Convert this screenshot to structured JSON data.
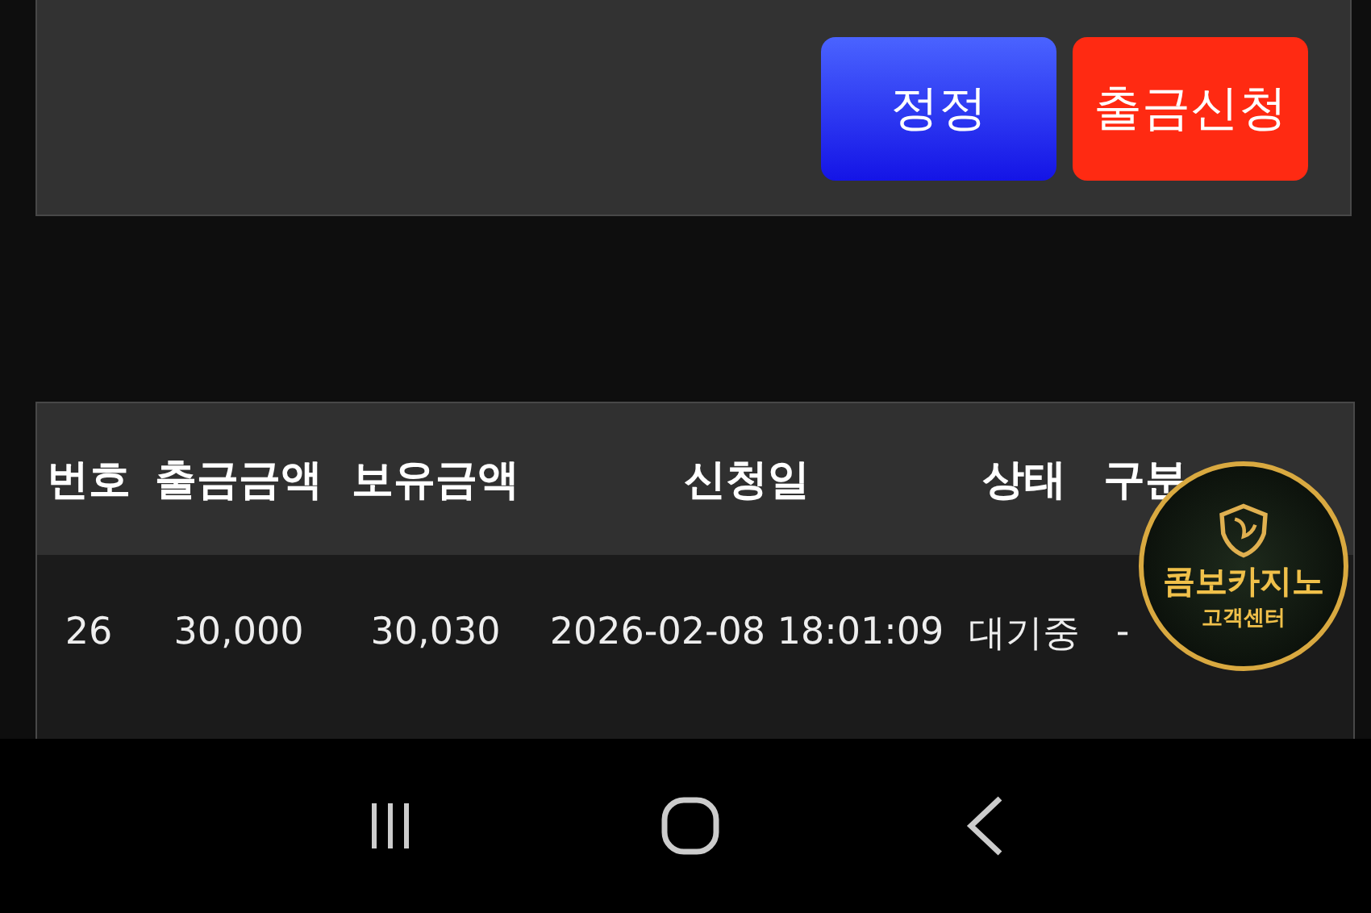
{
  "actions": [
    {
      "label": "정정",
      "kind": "edit"
    },
    {
      "label": "출금신청",
      "kind": "submit"
    }
  ],
  "table": {
    "columns": [
      "번호",
      "출금금액",
      "보유금액",
      "신청일",
      "상태",
      "구분"
    ],
    "rows": [
      [
        "26",
        "30,000",
        "30,030",
        "2026-02-08 18:01:09",
        "대기중",
        "-"
      ]
    ]
  },
  "support_badge": {
    "title": "콤보카지노",
    "subtitle": "고객센터"
  }
}
